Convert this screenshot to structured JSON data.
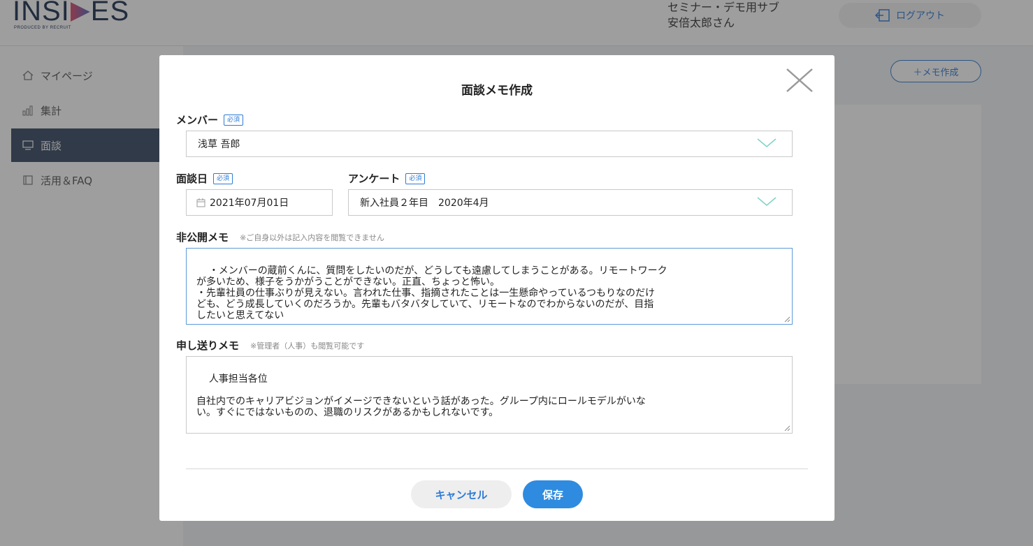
{
  "app": {
    "logo_text_left": "INSI",
    "logo_text_right": "ES",
    "logo_sub": "PRODUCED BY RECRUIT",
    "user_line1": "セミナー・デモ用サブ",
    "user_line2": "安倍太郎さん",
    "logout_label": "ログアウト"
  },
  "sidebar": {
    "items": [
      {
        "label": "マイページ",
        "icon": "home-icon"
      },
      {
        "label": "集計",
        "icon": "chart-icon"
      },
      {
        "label": "面談",
        "icon": "interview-icon",
        "active": true
      },
      {
        "label": "活用＆FAQ",
        "icon": "book-icon"
      }
    ]
  },
  "main": {
    "memo_create_label": "＋メモ作成"
  },
  "modal": {
    "title": "面談メモ作成",
    "required_badge": "必須",
    "member": {
      "label": "メンバー",
      "value": "浅草 吾郎"
    },
    "date": {
      "label": "面談日",
      "value": "2021年07月01日"
    },
    "survey": {
      "label": "アンケート",
      "value": "新入社員２年目　2020年4月"
    },
    "private_memo": {
      "label": "非公開メモ",
      "hint": "※ご自身以外は記入内容を閲覧できません",
      "value": "・メンバーの蔵前くんに、質問をしたいのだが、どうしても遠慮してしまうことがある。リモートワーク\nが多いため、様子をうかがうことができない。正直、ちょっと怖い。\n・先輩社員の仕事ぶりが見えない。言われた仕事、指摘されたことは一生懸命やっているつもりなのだけ\nども、どう成長していくのだろうか。先輩もバタバタしていて、リモートなのでわからないのだが、目指\nしたいと思えてない"
    },
    "handover_memo": {
      "label": "申し送りメモ",
      "hint": "※管理者（人事）も閲覧可能です",
      "value": "人事担当各位\n\n自社内でのキャリアビジョンがイメージできないという話があった。グループ内にロールモデルがいな\nい。すぐにではないものの、退職のリスクがあるかもしれないです。"
    },
    "cancel_label": "キャンセル",
    "save_label": "保存"
  },
  "colors": {
    "accent": "#2e7bd6",
    "save_button": "#2e8be0",
    "sidebar_active": "#3a4a63"
  }
}
